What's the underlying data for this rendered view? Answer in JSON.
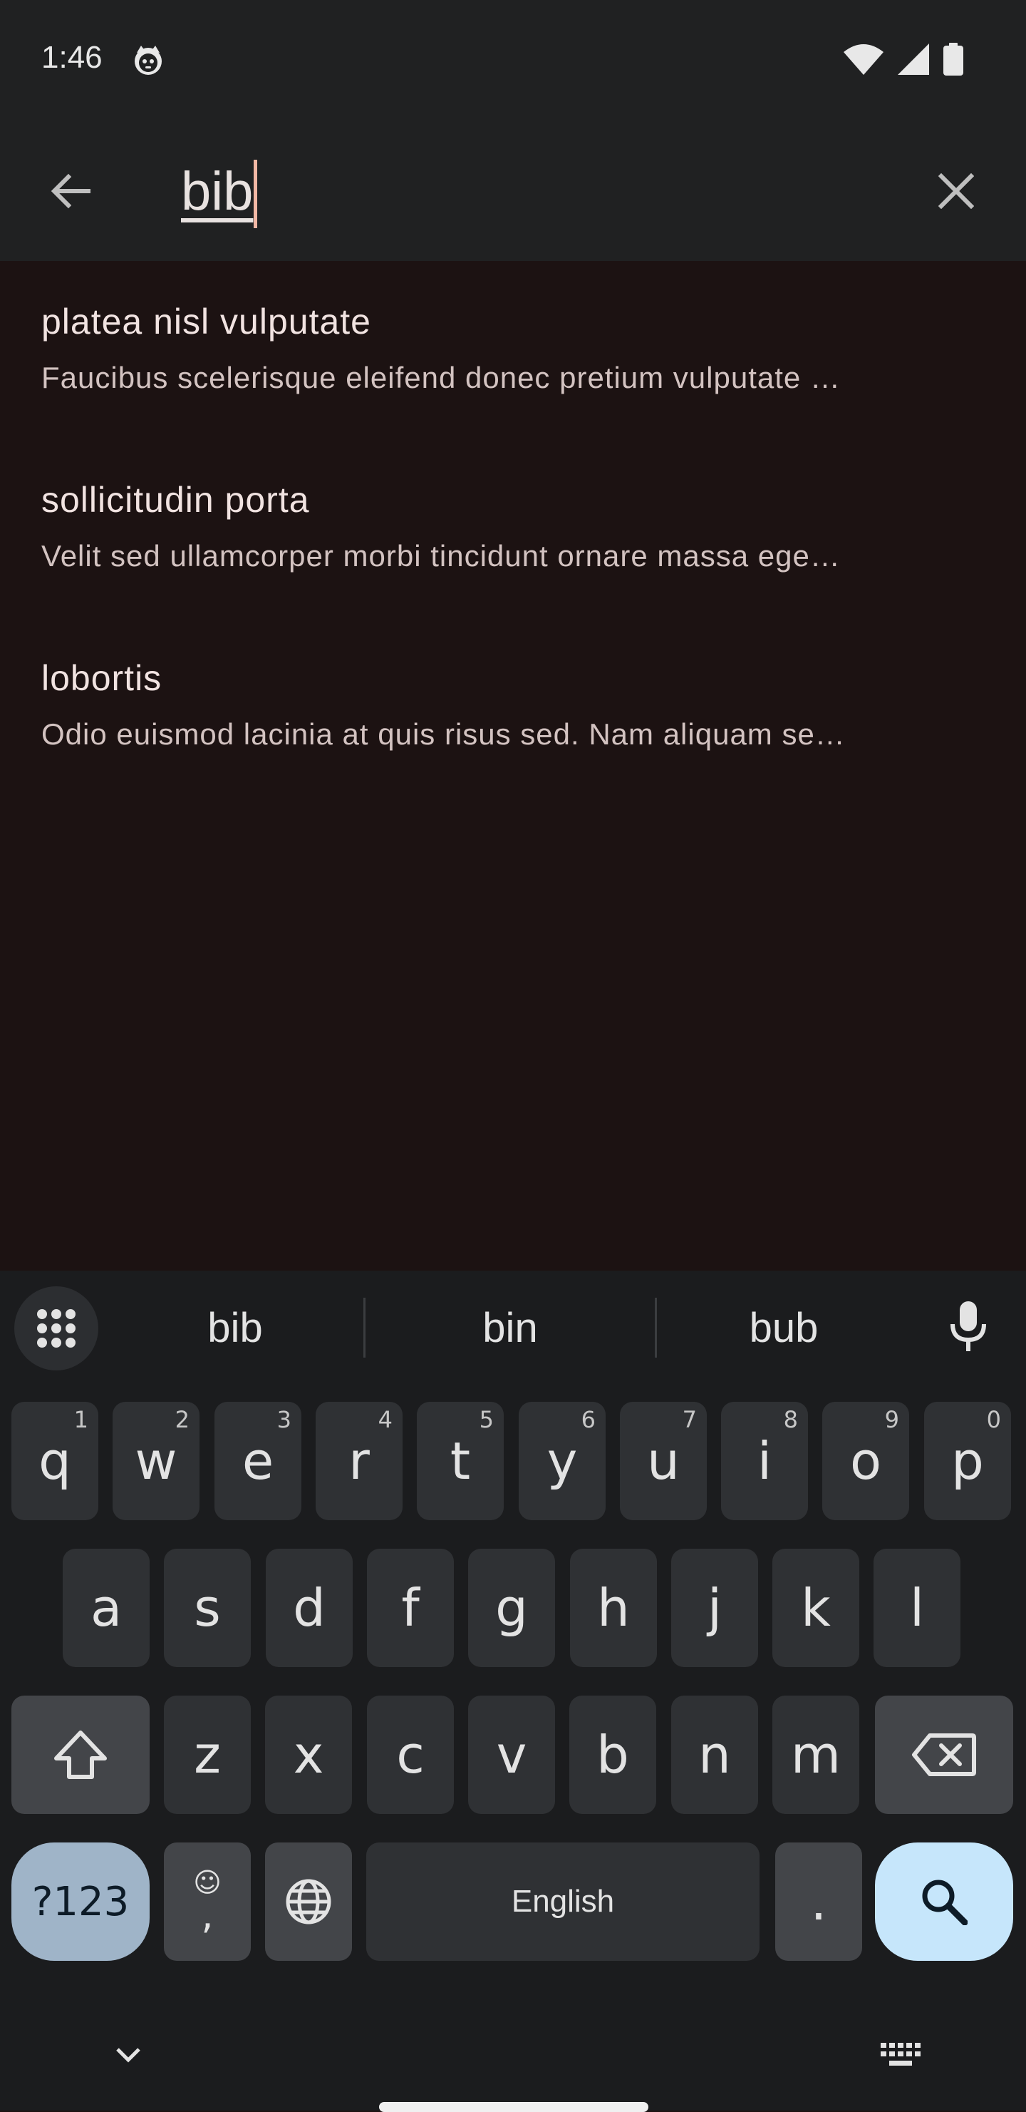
{
  "status_bar": {
    "time": "1:46",
    "app_icon": "cat-face-icon",
    "icons": [
      "wifi-icon",
      "cellular-signal-icon",
      "battery-icon"
    ]
  },
  "search": {
    "value": "bib",
    "back_icon": "arrow-back-icon",
    "clear_icon": "close-icon"
  },
  "results": [
    {
      "title": "platea nisl vulputate",
      "subtitle": "Faucibus scelerisque eleifend donec pretium vulputate …"
    },
    {
      "title": "sollicitudin porta",
      "subtitle": "Velit sed ullamcorper morbi tincidunt ornare massa ege…"
    },
    {
      "title": "lobortis",
      "subtitle": "Odio euismod lacinia at quis risus sed. Nam aliquam se…"
    }
  ],
  "keyboard": {
    "suggestions": [
      "bib",
      "bin",
      "bub"
    ],
    "row1": [
      {
        "key": "q",
        "hint": "1"
      },
      {
        "key": "w",
        "hint": "2"
      },
      {
        "key": "e",
        "hint": "3"
      },
      {
        "key": "r",
        "hint": "4"
      },
      {
        "key": "t",
        "hint": "5"
      },
      {
        "key": "y",
        "hint": "6"
      },
      {
        "key": "u",
        "hint": "7"
      },
      {
        "key": "i",
        "hint": "8"
      },
      {
        "key": "o",
        "hint": "9"
      },
      {
        "key": "p",
        "hint": "0"
      }
    ],
    "row2": [
      "a",
      "s",
      "d",
      "f",
      "g",
      "h",
      "j",
      "k",
      "l"
    ],
    "row3": [
      "z",
      "x",
      "c",
      "v",
      "b",
      "n",
      "m"
    ],
    "symbols_label": "?123",
    "emoji_label": "☺",
    "comma_label": ",",
    "space_label": "English",
    "period_label": ".",
    "accent_color": "#c6e6fb"
  }
}
